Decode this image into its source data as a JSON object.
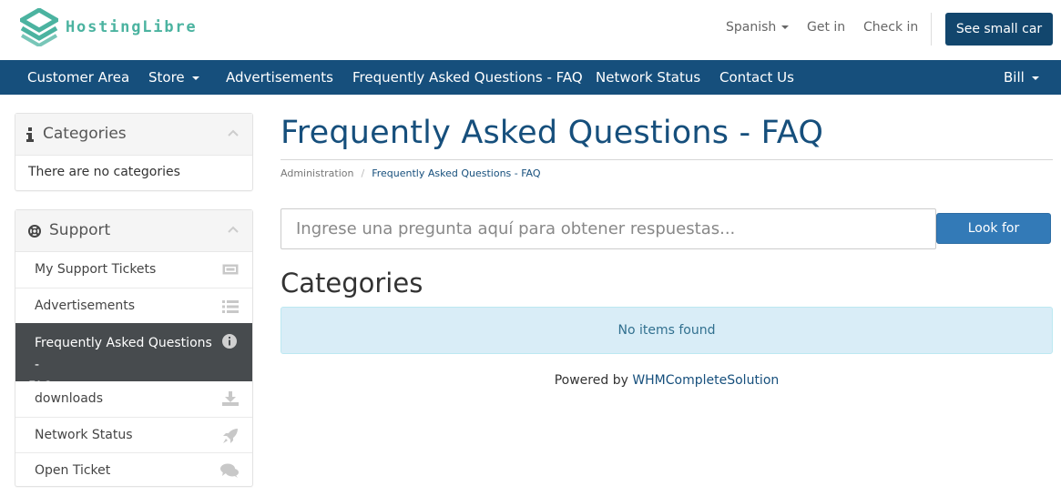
{
  "brand": {
    "name": "HostingLibre",
    "color": "#4bb3a0"
  },
  "topbar": {
    "language": "Spanish",
    "login": "Get in",
    "register": "Check in",
    "cart_button": "See small car"
  },
  "navbar": {
    "color": "#164f7c",
    "items": [
      {
        "label": "Customer Area"
      },
      {
        "label": "Store"
      },
      {
        "label": "Advertisements"
      },
      {
        "label": "Frequently Asked Questions - FAQ"
      },
      {
        "label": "Network Status"
      },
      {
        "label": "Contact Us"
      }
    ],
    "user": "Bill"
  },
  "sidebar": {
    "categories": {
      "title": "Categories",
      "icon": "info-icon",
      "empty_text": "There are no categories"
    },
    "support": {
      "title": "Support",
      "icon": "lifebuoy-icon",
      "items": [
        {
          "label": "My Support Tickets",
          "icon": "ticket-icon"
        },
        {
          "label": "Advertisements",
          "icon": "list-icon"
        },
        {
          "label_line1": "Frequently Asked Questions -",
          "label_line2": "FAQ",
          "icon": "info-circle-icon",
          "active": true
        },
        {
          "label": "downloads",
          "icon": "download-icon"
        },
        {
          "label": "Network Status",
          "icon": "rocket-icon"
        },
        {
          "label": "Open Ticket",
          "icon": "comments-icon"
        }
      ]
    }
  },
  "main": {
    "title": "Frequently Asked Questions - FAQ",
    "breadcrumb": {
      "root": "Administration",
      "current": "Frequently Asked Questions - FAQ"
    },
    "search": {
      "placeholder": "Ingrese una pregunta aquí para obtener respuestas...",
      "button": "Look for"
    },
    "section_title": "Categories",
    "empty_message": "No items found",
    "footer": {
      "prefix": "Powered by ",
      "link": "WHMCompleteSolution"
    }
  }
}
